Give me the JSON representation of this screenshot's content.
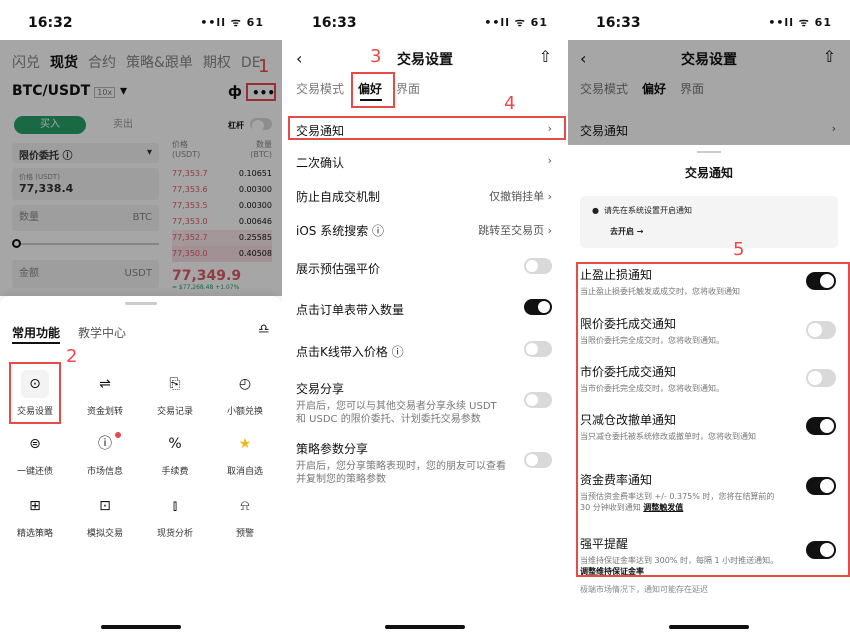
{
  "panel1": {
    "time": "16:32",
    "status": "••ll ᯤ 61",
    "top_tabs": [
      "闪兑",
      "现货",
      "合约",
      "策略&跟单",
      "期权",
      "DE"
    ],
    "pair": "BTC/USDT",
    "leverage": "10x",
    "chart_icon": "ф",
    "more": "•••",
    "buy": "买入",
    "sell": "卖出",
    "margin_label": "杠杆",
    "order_type": "限价委托 ⓘ",
    "price_label": "价格 (USDT)",
    "price_value": "77,338.4",
    "qty": "数量",
    "qty_unit": "BTC",
    "amount": "金额",
    "amount_unit": "USDT",
    "ob_head": [
      "价格",
      "数量"
    ],
    "ob_head2": [
      "(USDT)",
      "(BTC)"
    ],
    "orderbook": [
      [
        "77,353.7",
        "0.10651"
      ],
      [
        "77,353.6",
        "0.00300"
      ],
      [
        "77,353.5",
        "0.00300"
      ],
      [
        "77,353.0",
        "0.00646"
      ],
      [
        "77,352.7",
        "0.25585"
      ],
      [
        "77,350.0",
        "0.40508"
      ]
    ],
    "last_price": "77,349.9",
    "last_sub": "≈ $77,268.48 +1.07%",
    "sheet_tabs": [
      "常用功能",
      "教学中心"
    ],
    "grid": [
      {
        "label": "交易设置",
        "icon": "⊙"
      },
      {
        "label": "资金划转",
        "icon": "⇌"
      },
      {
        "label": "交易记录",
        "icon": "⎘"
      },
      {
        "label": "小额兑换",
        "icon": "◴"
      },
      {
        "label": "一键还债",
        "icon": "⊜"
      },
      {
        "label": "市场信息",
        "icon": "ⓘ"
      },
      {
        "label": "手续费",
        "icon": "%"
      },
      {
        "label": "取消自选",
        "icon": "★"
      },
      {
        "label": "精选策略",
        "icon": "⊞"
      },
      {
        "label": "模拟交易",
        "icon": "⊡"
      },
      {
        "label": "现货分析",
        "icon": "⫾"
      },
      {
        "label": "预警",
        "icon": "⍾"
      }
    ],
    "ann1": "1",
    "ann2": "2"
  },
  "panel2": {
    "time": "16:33",
    "status": "••ll ᯤ 61",
    "title": "交易设置",
    "tabs": [
      "交易模式",
      "偏好",
      "界面"
    ],
    "rows": [
      {
        "label": "交易通知",
        "value": "›"
      },
      {
        "label": "二次确认",
        "value": "›"
      },
      {
        "label": "防止自成交机制",
        "value": "仅撤销挂单 ›"
      },
      {
        "label": "iOS 系统搜索 ⓘ",
        "value": "跳转至交易页 ›"
      },
      {
        "label": "展示预估强平价"
      },
      {
        "label": "点击订单表带入数量"
      },
      {
        "label": "点击K线带入价格 ⓘ"
      },
      {
        "label": "交易分享",
        "desc": "开启后，您可以与其他交易者分享永续 USDT 和 USDC 的限价委托、计划委托交易参数"
      },
      {
        "label": "策略参数分享",
        "desc": "开启后，您分享策略表现时，您的朋友可以查看并复制您的策略参数"
      }
    ],
    "ann3": "3",
    "ann4": "4"
  },
  "panel3": {
    "time": "16:33",
    "status": "••ll ᯤ 61",
    "title": "交易设置",
    "tabs": [
      "交易模式",
      "偏好",
      "界面"
    ],
    "row": "交易通知",
    "sheet_title": "交易通知",
    "notice": "请先在系统设置开启通知",
    "notice_link": "去开启 →",
    "items": [
      {
        "title": "止盈止损通知",
        "desc": "当止盈止损委托触发或成交时，您将收到通知"
      },
      {
        "title": "限价委托成交通知",
        "desc": "当限价委托完全成交时，您将收到通知。"
      },
      {
        "title": "市价委托成交通知",
        "desc": "当市价委托完全成交时，您将收到通知。"
      },
      {
        "title": "只减仓改撤单通知",
        "desc": "当只减仓委托被系统修改或撤单时，您将收到通知"
      },
      {
        "title": "资金费率通知",
        "desc": "当预估资金费率达到 +/- 0.375% 时，您将在结算前的 30 分钟收到通知",
        "link": "调整触发值"
      },
      {
        "title": "强平提醒",
        "desc": "当维持保证金率达到 300% 时，每隔 1 小时推送通知。",
        "link": "调整维持保证金率"
      }
    ],
    "footer": "极端市场情况下，通知可能存在延迟",
    "ann5": "5"
  },
  "colors": {
    "accent_red": "#e84a4a",
    "buy_green": "#27a26b",
    "ask_red": "#e05b6b"
  }
}
